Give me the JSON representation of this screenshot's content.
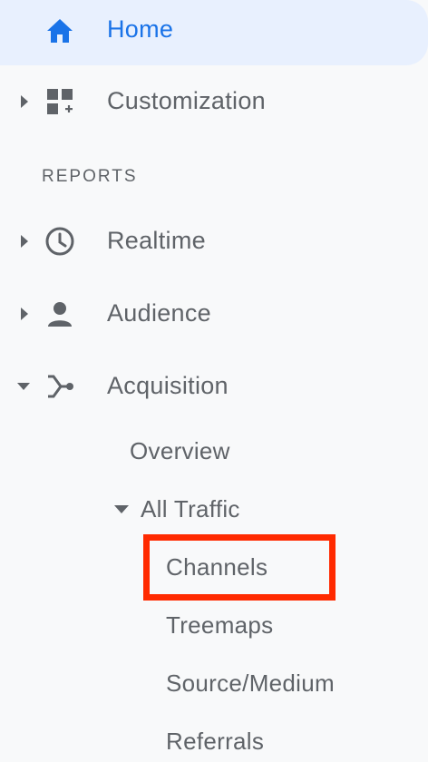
{
  "nav": {
    "home": {
      "label": "Home",
      "icon": "home-icon"
    },
    "customization": {
      "label": "Customization",
      "icon": "dashboard-add-icon"
    },
    "section_label": "REPORTS",
    "realtime": {
      "label": "Realtime",
      "icon": "clock-icon"
    },
    "audience": {
      "label": "Audience",
      "icon": "person-icon"
    },
    "acquisition": {
      "label": "Acquisition",
      "icon": "acquisition-branch-icon",
      "overview": "Overview",
      "all_traffic": {
        "label": "All Traffic",
        "children": [
          "Channels",
          "Treemaps",
          "Source/Medium",
          "Referrals"
        ]
      }
    }
  },
  "colors": {
    "active_text": "#1a73e8",
    "active_bg": "#e8f0fe",
    "text": "#5f6368",
    "highlight": "#ff2a00"
  }
}
